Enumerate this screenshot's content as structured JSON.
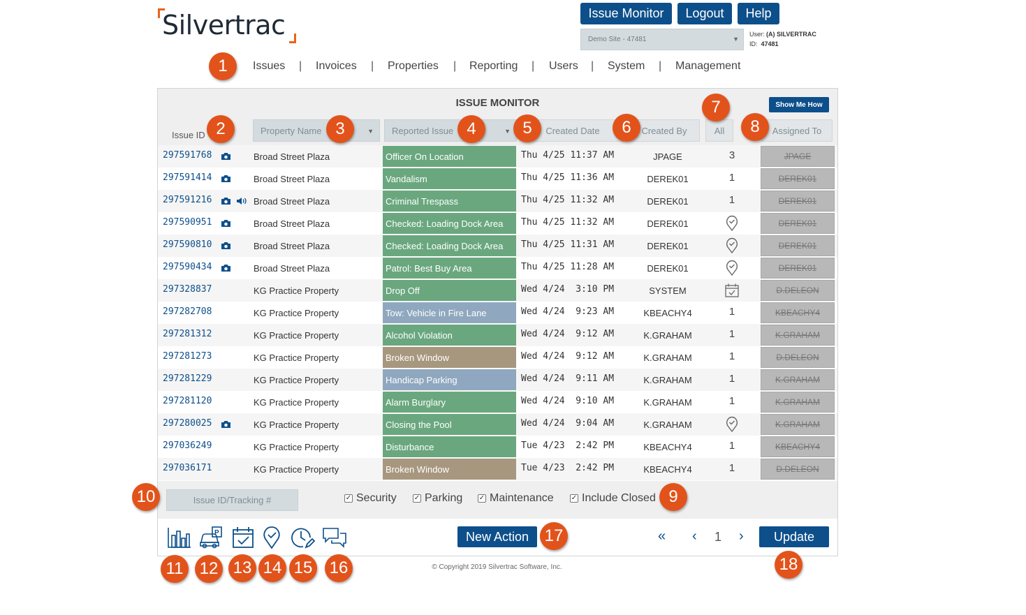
{
  "brand": {
    "name": "Silvertrac"
  },
  "header": {
    "buttons": {
      "issue_monitor": "Issue Monitor",
      "logout": "Logout",
      "help": "Help"
    },
    "site_select": "Demo Site - 47481",
    "user": {
      "user_label": "User:",
      "user_value": "(A) SILVERTRAC",
      "id_label": "ID:",
      "id_value": "47481"
    }
  },
  "nav": {
    "items": [
      "Issues",
      "Invoices",
      "Properties",
      "Reporting",
      "Users",
      "System",
      "Management"
    ],
    "separator": "|"
  },
  "panel": {
    "title": "ISSUE MONITOR",
    "show_me_how": "Show Me How",
    "columns": {
      "issue_id": "Issue ID",
      "property": "Property Name",
      "reported_issue": "Reported Issue",
      "created_date": "Created Date",
      "created_by": "Created By",
      "count_filter": "All",
      "assigned_to": "Assigned To"
    }
  },
  "rows": [
    {
      "id": "297591768",
      "camera": true,
      "audio": false,
      "property": "Broad Street Plaza",
      "issue": "Officer On Location",
      "issue_color": "#6aa77e",
      "date": "Thu 4/25 11:37 AM",
      "by": "JPAGE",
      "count": "3",
      "marker": "count",
      "assigned": "JPAGE"
    },
    {
      "id": "297591414",
      "camera": true,
      "audio": false,
      "property": "Broad Street Plaza",
      "issue": "Vandalism",
      "issue_color": "#6aa77e",
      "date": "Thu 4/25 11:36 AM",
      "by": "DEREK01",
      "count": "1",
      "marker": "count",
      "assigned": "DEREK01"
    },
    {
      "id": "297591216",
      "camera": true,
      "audio": true,
      "property": "Broad Street Plaza",
      "issue": "Criminal Trespass",
      "issue_color": "#6aa77e",
      "date": "Thu 4/25 11:32 AM",
      "by": "DEREK01",
      "count": "1",
      "marker": "count",
      "assigned": "DEREK01"
    },
    {
      "id": "297590951",
      "camera": true,
      "audio": false,
      "property": "Broad Street Plaza",
      "issue": "Checked: Loading Dock Area",
      "issue_color": "#6aa77e",
      "date": "Thu 4/25 11:32 AM",
      "by": "DEREK01",
      "count": "",
      "marker": "pin",
      "assigned": "DEREK01"
    },
    {
      "id": "297590810",
      "camera": true,
      "audio": false,
      "property": "Broad Street Plaza",
      "issue": "Checked: Loading Dock Area",
      "issue_color": "#6aa77e",
      "date": "Thu 4/25 11:31 AM",
      "by": "DEREK01",
      "count": "",
      "marker": "pin",
      "assigned": "DEREK01"
    },
    {
      "id": "297590434",
      "camera": true,
      "audio": false,
      "property": "Broad Street Plaza",
      "issue": "Patrol: Best Buy Area",
      "issue_color": "#6aa77e",
      "date": "Thu 4/25 11:28 AM",
      "by": "DEREK01",
      "count": "",
      "marker": "pin",
      "assigned": "DEREK01"
    },
    {
      "id": "297328837",
      "camera": false,
      "audio": false,
      "property": "KG Practice Property",
      "issue": "Drop Off",
      "issue_color": "#6aa77e",
      "date": "Wed 4/24  3:10 PM",
      "by": "SYSTEM",
      "count": "",
      "marker": "calendar",
      "assigned": "D.DELEON"
    },
    {
      "id": "297282708",
      "camera": false,
      "audio": false,
      "property": "KG Practice Property",
      "issue": "Tow: Vehicle in Fire Lane",
      "issue_color": "#8fa8bf",
      "date": "Wed 4/24  9:23 AM",
      "by": "KBEACHY4",
      "count": "1",
      "marker": "count",
      "assigned": "KBEACHY4"
    },
    {
      "id": "297281312",
      "camera": false,
      "audio": false,
      "property": "KG Practice Property",
      "issue": "Alcohol Violation",
      "issue_color": "#6aa77e",
      "date": "Wed 4/24  9:12 AM",
      "by": "K.GRAHAM",
      "count": "1",
      "marker": "count",
      "assigned": "K.GRAHAM"
    },
    {
      "id": "297281273",
      "camera": false,
      "audio": false,
      "property": "KG Practice Property",
      "issue": "Broken Window",
      "issue_color": "#a8977f",
      "date": "Wed 4/24  9:12 AM",
      "by": "K.GRAHAM",
      "count": "1",
      "marker": "count",
      "assigned": "D.DELEON"
    },
    {
      "id": "297281229",
      "camera": false,
      "audio": false,
      "property": "KG Practice Property",
      "issue": "Handicap Parking",
      "issue_color": "#8fa8bf",
      "date": "Wed 4/24  9:11 AM",
      "by": "K.GRAHAM",
      "count": "1",
      "marker": "count",
      "assigned": "K.GRAHAM"
    },
    {
      "id": "297281120",
      "camera": false,
      "audio": false,
      "property": "KG Practice Property",
      "issue": "Alarm Burglary",
      "issue_color": "#6aa77e",
      "date": "Wed 4/24  9:10 AM",
      "by": "K.GRAHAM",
      "count": "1",
      "marker": "count",
      "assigned": "K.GRAHAM"
    },
    {
      "id": "297280025",
      "camera": true,
      "audio": false,
      "property": "KG Practice Property",
      "issue": "Closing the Pool",
      "issue_color": "#6aa77e",
      "date": "Wed 4/24  9:04 AM",
      "by": "K.GRAHAM",
      "count": "",
      "marker": "pin",
      "assigned": "K.GRAHAM"
    },
    {
      "id": "297036249",
      "camera": false,
      "audio": false,
      "property": "KG Practice Property",
      "issue": "Disturbance",
      "issue_color": "#6aa77e",
      "date": "Tue 4/23  2:42 PM",
      "by": "KBEACHY4",
      "count": "1",
      "marker": "count",
      "assigned": "KBEACHY4"
    },
    {
      "id": "297036171",
      "camera": false,
      "audio": false,
      "property": "KG Practice Property",
      "issue": "Broken Window",
      "issue_color": "#a8977f",
      "date": "Tue 4/23  2:42 PM",
      "by": "KBEACHY4",
      "count": "1",
      "marker": "count",
      "assigned": "D.DELEON"
    }
  ],
  "filters": {
    "tracking_placeholder": "Issue ID/Tracking #",
    "checkboxes": [
      {
        "label": "Security",
        "checked": true
      },
      {
        "label": "Parking",
        "checked": true
      },
      {
        "label": "Maintenance",
        "checked": true
      },
      {
        "label": "Include Closed",
        "checked": true
      }
    ]
  },
  "toolbar": {
    "icons": [
      "bar-chart-icon",
      "parking-car-icon",
      "calendar-check-icon",
      "location-pin-icon",
      "clock-edit-icon",
      "chat-bubbles-icon"
    ],
    "new_action": "New Action",
    "pager": {
      "first": "«",
      "prev": "‹",
      "page": "1",
      "next": "›"
    },
    "update": "Update"
  },
  "footer": {
    "copyright": "© Copyright 2019 Silvertrac Software, Inc."
  },
  "callouts": [
    "1",
    "2",
    "3",
    "4",
    "5",
    "6",
    "7",
    "8",
    "9",
    "10",
    "11",
    "12",
    "13",
    "14",
    "15",
    "16",
    "17",
    "18"
  ],
  "colors": {
    "primary": "#0d4f8b",
    "accent": "#e8641b",
    "callout": "#e2531b",
    "issue_green": "#6aa77e",
    "issue_blue": "#8fa8bf",
    "issue_brown": "#a8977f"
  }
}
